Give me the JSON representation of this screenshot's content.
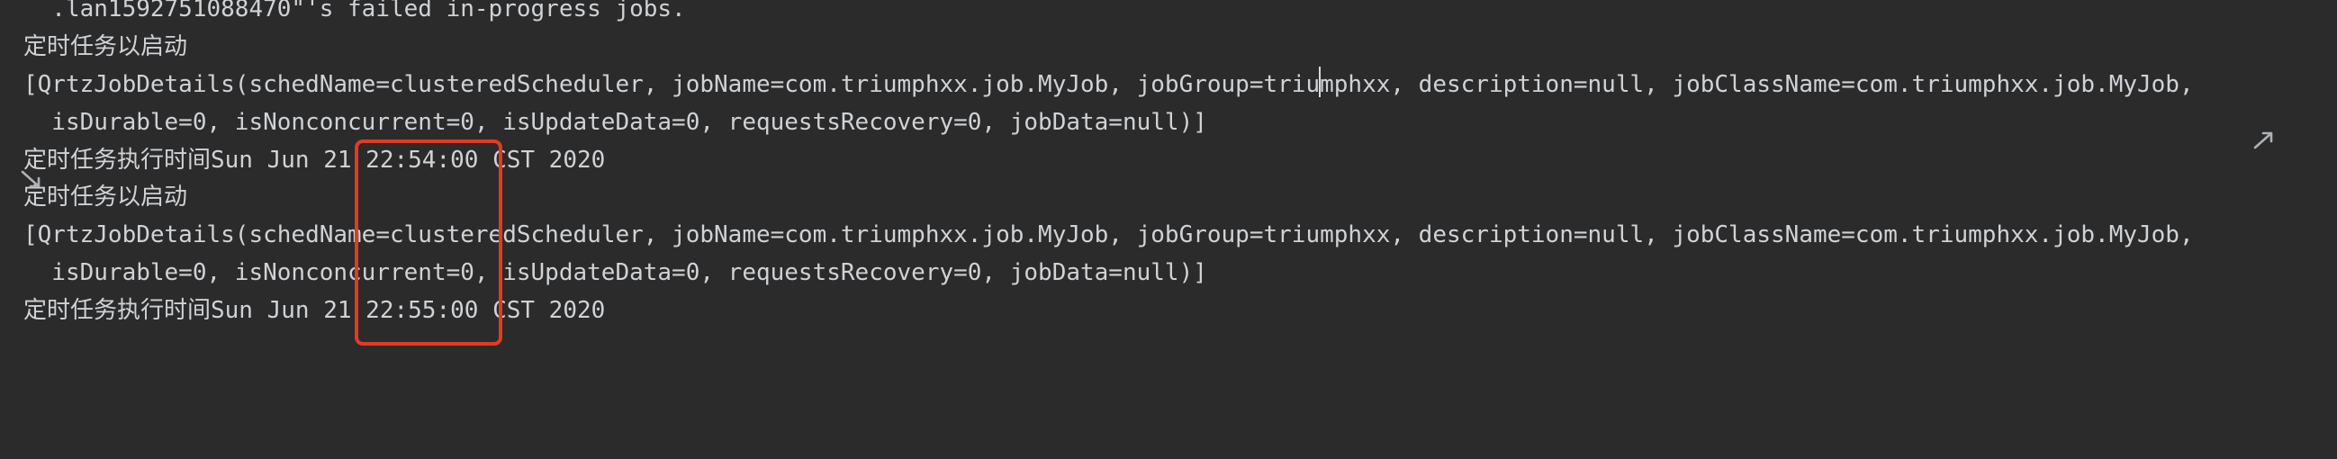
{
  "console": {
    "lines": [
      "  .lan1592751088470\"'s failed in-progress jobs.",
      "定时任务以启动",
      "[QrtzJobDetails(schedName=clusteredScheduler, jobName=com.triumphxx.job.MyJob, jobGroup=triumphxx, description=null, jobClassName=com.triumphxx.job.MyJob,",
      "  isDurable=0, isNonconcurrent=0, isUpdateData=0, requestsRecovery=0, jobData=null)]",
      "定时任务执行时间Sun Jun 21 22:54:00 CST 2020",
      "定时任务以启动",
      "[QrtzJobDetails(schedName=clusteredScheduler, jobName=com.triumphxx.job.MyJob, jobGroup=triumphxx, description=null, jobClassName=com.triumphxx.job.MyJob,",
      "  isDurable=0, isNonconcurrent=0, isUpdateData=0, requestsRecovery=0, jobData=null)]",
      "定时任务执行时间Sun Jun 21 22:55:00 CST 2020"
    ]
  },
  "icons": {
    "wrap_start": "soft-wrap-start-icon",
    "wrap_end": "soft-wrap-end-icon"
  },
  "colors": {
    "background": "#2b2b2b",
    "text": "#cfd2d6",
    "highlight": "#e33a24"
  }
}
